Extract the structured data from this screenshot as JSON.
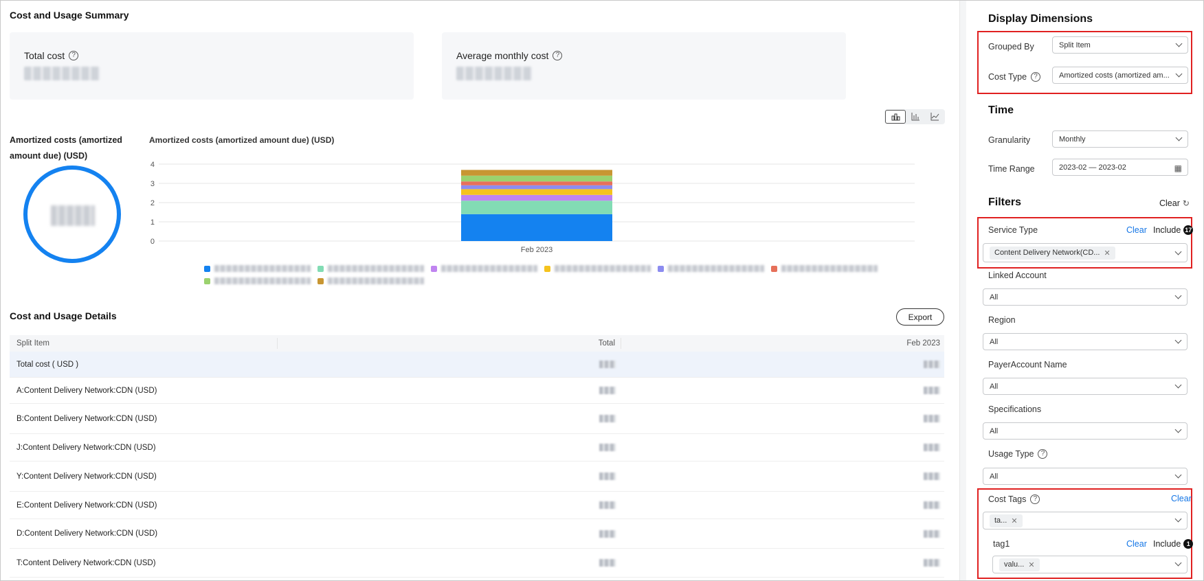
{
  "summary": {
    "title": "Cost and Usage Summary",
    "total_cost_label": "Total cost",
    "avg_monthly_label": "Average monthly cost",
    "help_glyph": "?"
  },
  "chart_toggle": [
    "chart-pie-icon",
    "chart-bar-icon",
    "chart-line-icon"
  ],
  "donut": {
    "label": "Amortized costs (amortized amount due) (USD)",
    "color": "#1482f0"
  },
  "chart_data": {
    "type": "bar",
    "title": "Amortized costs (amortized amount due) (USD)",
    "categories": [
      "Feb 2023"
    ],
    "ylim": [
      0,
      4
    ],
    "yticks": [
      "0",
      "1",
      "2",
      "3",
      "4"
    ],
    "stacked": true,
    "series": [
      {
        "color": "#1482f0",
        "values": [
          1.4
        ]
      },
      {
        "color": "#82dcb4",
        "values": [
          0.7
        ]
      },
      {
        "color": "#c084f0",
        "values": [
          0.3
        ]
      },
      {
        "color": "#f5c31e",
        "values": [
          0.3
        ]
      },
      {
        "color": "#8c8cf0",
        "values": [
          0.2
        ]
      },
      {
        "color": "#e6705a",
        "values": [
          0.2
        ]
      },
      {
        "color": "#9bd26e",
        "values": [
          0.3
        ]
      },
      {
        "color": "#c89632",
        "values": [
          0.3
        ]
      }
    ]
  },
  "details": {
    "title": "Cost and Usage Details",
    "export_label": "Export",
    "columns": [
      "Split Item",
      "Total",
      "Feb 2023"
    ],
    "rows": [
      "Total cost ( USD )",
      "A:Content Delivery Network:CDN (USD)",
      "B:Content Delivery Network:CDN (USD)",
      "J:Content Delivery Network:CDN (USD)",
      "Y:Content Delivery Network:CDN (USD)",
      "E:Content Delivery Network:CDN (USD)",
      "D:Content Delivery Network:CDN (USD)",
      "T:Content Delivery Network:CDN (USD)"
    ]
  },
  "sidebar": {
    "display_title": "Display Dimensions",
    "grouped_by_label": "Grouped By",
    "grouped_by_value": "Split Item",
    "cost_type_label": "Cost Type",
    "cost_type_value": "Amortized costs (amortized am...",
    "time_title": "Time",
    "granularity_label": "Granularity",
    "granularity_value": "Monthly",
    "time_range_label": "Time Range",
    "time_range_value": "2023-02 — 2023-02",
    "filters_title": "Filters",
    "filters_clear": "Clear",
    "service_type_label": "Service Type",
    "service_type_chip": "Content Delivery Network(CD...",
    "service_type_count": "17",
    "clear_label": "Clear",
    "include_label": "Include",
    "linked_account_label": "Linked Account",
    "region_label": "Region",
    "payer_account_label": "PayerAccount Name",
    "specifications_label": "Specifications",
    "usage_type_label": "Usage Type",
    "all_value": "All",
    "cost_tags_label": "Cost Tags",
    "cost_tags_chip": "ta...",
    "tag1_label": "tag1",
    "tag1_count": "1",
    "tag1_chip": "valu..."
  }
}
